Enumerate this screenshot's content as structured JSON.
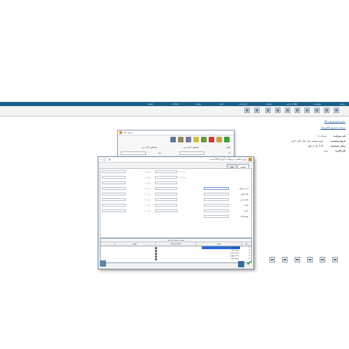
{
  "menubar": {
    "items": [
      "برنامه",
      "تنظیمات",
      "اطلاعات پایه",
      "عملیات",
      "گزارشات",
      "ابزار",
      "پنجره",
      "امکانات",
      "راهنما"
    ]
  },
  "side_links": {
    "link1": "ذخیره نامه فرمان کالا",
    "link2": "دریافت صندوق الکترونیک"
  },
  "info_panel": {
    "rows": [
      {
        "label": "نام شرکت:",
        "value": "شرکت 1"
      },
      {
        "label": "تاریخ سیستم:",
        "value": "تاریخ سیستم برای سال مالی جاری"
      },
      {
        "label": "زمان سیستم:",
        "value": "1:21 بعد از ظهر"
      },
      {
        "label": "نام کاربر:",
        "value": "مدیر"
      }
    ]
  },
  "back_dialog": {
    "title": "تعریف کالا",
    "filter_label": "فیلتر",
    "check1": "جستجو با کل متن",
    "check2": "جستجو با کل متن",
    "code_label": "کد",
    "name_label": "نام",
    "code_value": ""
  },
  "front_dialog": {
    "title": "ورود مقادیر مربوط به گروه کالا/خدمت",
    "tabs": [
      "عمومی",
      "سایر"
    ],
    "right_labels": [
      "کد و عنوان",
      "نام اصلی",
      "نام فرعی",
      "نام 1",
      "نام 2",
      "توضیحات"
    ],
    "field_labels": [
      "ویژگی 1",
      "ویژگی 2",
      "ویژگی 3",
      "ویژگی 4",
      "ویژگی 5",
      "ویژگی 6",
      "ویژگی 7",
      "ویژگی 8",
      "ویژگی 9",
      "ویژگی 10"
    ],
    "grid": {
      "caption": "لیست دسته بندی ها",
      "columns": [
        "ردیف",
        "شرح",
        "فعال/غیرفعال",
        "عنوان"
      ],
      "rows": [
        {
          "num": "1",
          "desc": "دسته اول"
        },
        {
          "num": "2",
          "desc": "دسته دوم"
        },
        {
          "num": "3",
          "desc": "دسته سوم"
        },
        {
          "num": "4",
          "desc": "دسته چهارم"
        },
        {
          "num": "5",
          "desc": "دسته پنجم"
        }
      ]
    }
  }
}
